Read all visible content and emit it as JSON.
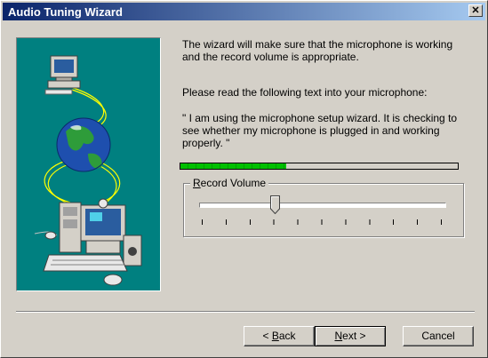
{
  "window": {
    "title": "Audio Tuning Wizard",
    "close_glyph": "✕"
  },
  "body": {
    "intro": "The wizard will make sure that the microphone is working and the record volume is appropriate.",
    "instruction": "Please read the following text into your microphone:",
    "quote": "\" I am using the microphone setup wizard. It is checking to see whether my microphone is plugged in and working properly. \""
  },
  "level_meter": {
    "level": 0.38,
    "color": "#00c000"
  },
  "record_volume": {
    "label_prefix": "",
    "label_accel": "R",
    "label_rest": "ecord Volume",
    "value": 0.3,
    "tick_count": 11
  },
  "buttons": {
    "back_prefix": "< ",
    "back_accel": "B",
    "back_rest": "ack",
    "next_accel": "N",
    "next_rest": "ext >",
    "cancel": "Cancel"
  },
  "colors": {
    "title_bar": "#0a246a",
    "panel_bg": "#d4d0c8",
    "illustration_bg": "#008080"
  },
  "icons": [
    "close-icon",
    "computer-icon",
    "globe-icon",
    "multimedia-computer-icon",
    "mouse-icon",
    "keyboard-icon",
    "speaker-icon"
  ]
}
